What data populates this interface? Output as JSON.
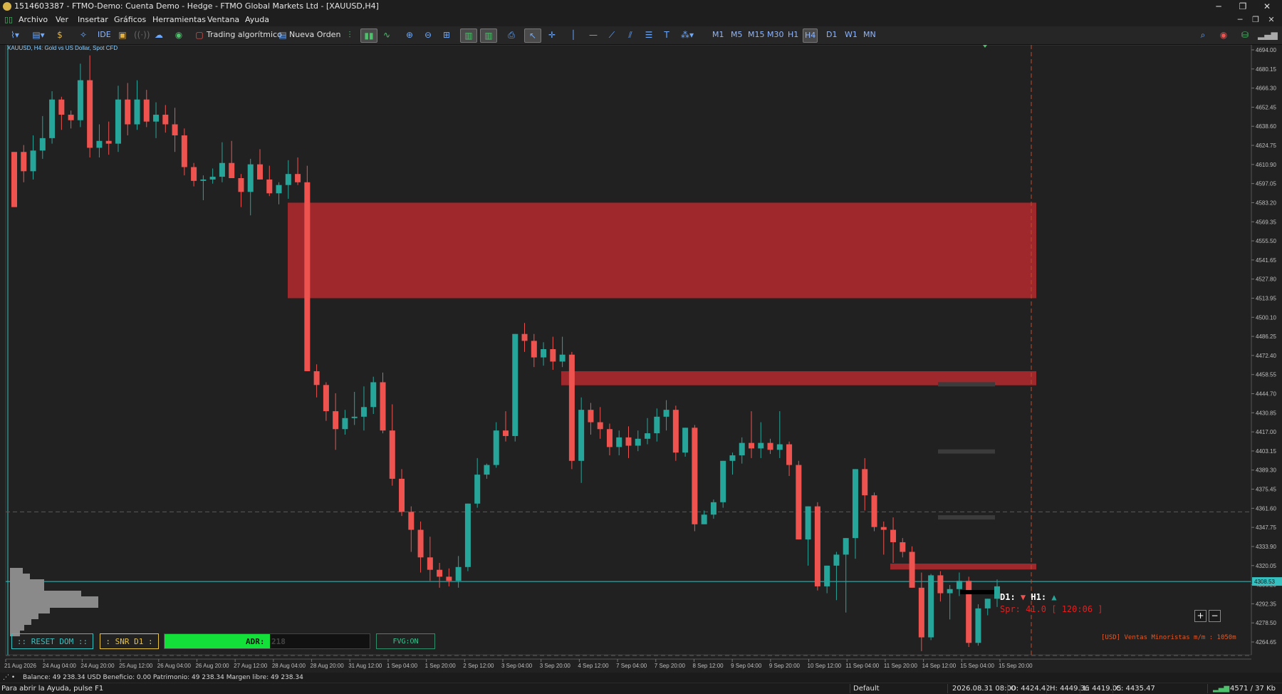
{
  "window": {
    "title": "1514603387 - FTMO-Demo: Cuenta Demo - Hedge - FTMO Global Markets Ltd - [XAUUSD,H4]",
    "controls": [
      "─",
      "❐",
      "✕"
    ]
  },
  "menu": {
    "items": [
      "Archivo",
      "Ver",
      "Insertar",
      "Gráficos",
      "Herramientas",
      "Ventana",
      "Ayuda"
    ],
    "mdi_controls": [
      "─",
      "❐",
      "✕"
    ]
  },
  "toolbar": {
    "ide_label": "IDE",
    "algo_label": "Trading algorítmico",
    "order_label": "Nueva Orden",
    "timeframes": [
      "M1",
      "M5",
      "M15",
      "M30",
      "H1",
      "H4",
      "D1",
      "W1",
      "MN"
    ],
    "active_timeframe": "H4"
  },
  "chart": {
    "symbol_label": "XAUUSD, H4:  Gold vs US Dollar, Spot CFD",
    "current_price": "4308.53",
    "price_labels": [
      "4694.00",
      "4680.15",
      "4666.30",
      "4652.45",
      "4638.60",
      "4624.75",
      "4610.90",
      "4597.05",
      "4583.20",
      "4569.35",
      "4555.50",
      "4541.65",
      "4527.80",
      "4513.95",
      "4500.10",
      "4486.25",
      "4472.40",
      "4458.55",
      "4444.70",
      "4430.85",
      "4417.00",
      "4403.15",
      "4389.30",
      "4375.45",
      "4361.60",
      "4347.75",
      "4333.90",
      "4320.05",
      "4306.20",
      "4292.35",
      "4278.50",
      "4264.65"
    ],
    "time_labels": [
      "21 Aug 2026",
      "24 Aug 04:00",
      "24 Aug 20:00",
      "25 Aug 12:00",
      "26 Aug 04:00",
      "26 Aug 20:00",
      "27 Aug 12:00",
      "28 Aug 04:00",
      "28 Aug 20:00",
      "31 Aug 12:00",
      "1 Sep 04:00",
      "1 Sep 20:00",
      "2 Sep 12:00",
      "3 Sep 04:00",
      "3 Sep 20:00",
      "4 Sep 12:00",
      "7 Sep 04:00",
      "7 Sep 20:00",
      "8 Sep 12:00",
      "9 Sep 04:00",
      "9 Sep 20:00",
      "10 Sep 12:00",
      "11 Sep 04:00",
      "11 Sep 20:00",
      "14 Sep 12:00",
      "15 Sep 04:00",
      "15 Sep 20:00"
    ],
    "candles": [
      [
        4620,
        4608,
        4586,
        4580
      ],
      [
        4620,
        4625,
        4598,
        4606
      ],
      [
        4606,
        4632,
        4600,
        4621
      ],
      [
        4621,
        4646,
        4615,
        4630
      ],
      [
        4630,
        4664,
        4626,
        4658
      ],
      [
        4658,
        4660,
        4636,
        4647
      ],
      [
        4647,
        4650,
        4637,
        4643
      ],
      [
        4643,
        4684,
        4638,
        4672
      ],
      [
        4672,
        4690,
        4616,
        4623
      ],
      [
        4623,
        4640,
        4616,
        4628
      ],
      [
        4628,
        4642,
        4618,
        4626
      ],
      [
        4626,
        4668,
        4620,
        4658
      ],
      [
        4658,
        4670,
        4632,
        4640
      ],
      [
        4640,
        4672,
        4636,
        4658
      ],
      [
        4658,
        4665,
        4638,
        4642
      ],
      [
        4642,
        4656,
        4630,
        4647
      ],
      [
        4647,
        4654,
        4634,
        4640
      ],
      [
        4640,
        4652,
        4620,
        4632
      ],
      [
        4632,
        4637,
        4603,
        4609
      ],
      [
        4609,
        4612,
        4595,
        4599
      ],
      [
        4599,
        4603,
        4585,
        4600
      ],
      [
        4600,
        4608,
        4597,
        4602
      ],
      [
        4602,
        4627,
        4598,
        4612
      ],
      [
        4612,
        4628,
        4604,
        4601
      ],
      [
        4601,
        4604,
        4580,
        4591
      ],
      [
        4591,
        4615,
        4574,
        4611
      ],
      [
        4611,
        4622,
        4602,
        4600
      ],
      [
        4600,
        4610,
        4588,
        4590
      ],
      [
        4590,
        4598,
        4582,
        4596
      ],
      [
        4596,
        4614,
        4586,
        4604
      ],
      [
        4604,
        4616,
        4596,
        4598
      ],
      [
        4598,
        4610,
        4535,
        4461
      ],
      [
        4461,
        4466,
        4442,
        4451
      ],
      [
        4451,
        4453,
        4425,
        4432
      ],
      [
        4432,
        4445,
        4404,
        4419
      ],
      [
        4419,
        4433,
        4415,
        4427
      ],
      [
        4427,
        4446,
        4422,
        4428
      ],
      [
        4428,
        4450,
        4418,
        4435
      ],
      [
        4435,
        4457,
        4430,
        4453
      ],
      [
        4453,
        4460,
        4416,
        4418
      ],
      [
        4418,
        4437,
        4378,
        4383
      ],
      [
        4383,
        4390,
        4356,
        4359
      ],
      [
        4359,
        4363,
        4330,
        4346
      ],
      [
        4346,
        4352,
        4315,
        4326
      ],
      [
        4326,
        4341,
        4309,
        4317
      ],
      [
        4317,
        4322,
        4304,
        4312
      ],
      [
        4312,
        4318,
        4305,
        4309
      ],
      [
        4309,
        4327,
        4304,
        4319
      ],
      [
        4319,
        4362,
        4316,
        4365
      ],
      [
        4365,
        4398,
        4362,
        4386
      ],
      [
        4386,
        4394,
        4383,
        4393
      ],
      [
        4393,
        4424,
        4391,
        4418
      ],
      [
        4418,
        4432,
        4410,
        4414
      ],
      [
        4414,
        4474,
        4410,
        4488
      ],
      [
        4488,
        4496,
        4475,
        4483
      ],
      [
        4483,
        4488,
        4464,
        4471
      ],
      [
        4471,
        4482,
        4465,
        4477
      ],
      [
        4477,
        4486,
        4462,
        4468
      ],
      [
        4468,
        4486,
        4464,
        4473
      ],
      [
        4473,
        4475,
        4390,
        4396
      ],
      [
        4396,
        4442,
        4380,
        4433
      ],
      [
        4433,
        4438,
        4415,
        4424
      ],
      [
        4424,
        4435,
        4412,
        4419
      ],
      [
        4419,
        4423,
        4400,
        4406
      ],
      [
        4406,
        4418,
        4400,
        4413
      ],
      [
        4413,
        4421,
        4398,
        4407
      ],
      [
        4407,
        4418,
        4403,
        4412
      ],
      [
        4412,
        4427,
        4408,
        4416
      ],
      [
        4416,
        4434,
        4410,
        4428
      ],
      [
        4428,
        4440,
        4418,
        4433
      ],
      [
        4433,
        4436,
        4396,
        4402
      ],
      [
        4402,
        4418,
        4399,
        4420
      ],
      [
        4420,
        4422,
        4345,
        4350
      ],
      [
        4350,
        4360,
        4352,
        4357
      ],
      [
        4357,
        4368,
        4354,
        4366
      ],
      [
        4366,
        4394,
        4362,
        4396
      ],
      [
        4396,
        4402,
        4386,
        4400
      ],
      [
        4400,
        4413,
        4394,
        4409
      ],
      [
        4409,
        4432,
        4398,
        4405
      ],
      [
        4405,
        4424,
        4398,
        4409
      ],
      [
        4409,
        4412,
        4401,
        4404
      ],
      [
        4404,
        4432,
        4398,
        4408
      ],
      [
        4408,
        4410,
        4385,
        4393
      ],
      [
        4393,
        4396,
        4363,
        4339
      ],
      [
        4339,
        4350,
        4320,
        4363
      ],
      [
        4363,
        4366,
        4302,
        4305
      ],
      [
        4305,
        4318,
        4300,
        4320
      ],
      [
        4320,
        4330,
        4295,
        4328
      ],
      [
        4328,
        4339,
        4286,
        4340
      ],
      [
        4340,
        4390,
        4325,
        4390
      ],
      [
        4390,
        4398,
        4360,
        4371
      ],
      [
        4371,
        4373,
        4345,
        4348
      ],
      [
        4348,
        4352,
        4328,
        4346
      ],
      [
        4346,
        4355,
        4322,
        4337
      ],
      [
        4337,
        4340,
        4326,
        4330
      ],
      [
        4330,
        4334,
        4308,
        4304
      ],
      [
        4304,
        4315,
        4258,
        4268
      ],
      [
        4268,
        4314,
        4266,
        4313
      ],
      [
        4313,
        4316,
        4294,
        4300
      ],
      [
        4300,
        4306,
        4281,
        4303
      ],
      [
        4303,
        4315,
        4298,
        4309
      ],
      [
        4309,
        4312,
        4261,
        4264
      ],
      [
        4264,
        4292,
        4262,
        4289
      ],
      [
        4289,
        4295,
        4284,
        4296
      ],
      [
        4296,
        4310,
        4290,
        4305
      ]
    ],
    "zones": [
      {
        "top": 4583.2,
        "bottom": 4513.95,
        "color": "#a6292d"
      },
      {
        "top": 4461.0,
        "bottom": 4450.8,
        "color": "#a6292d"
      },
      {
        "top": 4321.5,
        "bottom": 4317.2,
        "color": "#a6292d"
      }
    ],
    "gray_levels": [
      4451.5,
      4402.8,
      4355.0
    ],
    "dashed_level": 4359.0,
    "overlays": {
      "reset_dom": ":: RESET DOM ::",
      "snr_d1": ": SNR D1 :",
      "adr_label": "ADR:",
      "adr_value": "218",
      "fvg": "FVG:ON",
      "d1_label": "D1:",
      "d1_arrow": "▼",
      "h1_label": "H1:",
      "h1_arrow": "▲",
      "spread_line": "Spr: 41.0 [ 120:06 ]",
      "retail_line": "[USD] Ventas Minoristas m/m : 1050m",
      "zoom_in": "+",
      "zoom_out": "−"
    },
    "colors": {
      "bull": "#26a69a",
      "bear": "#ef5350",
      "zone": "#a6292d",
      "price_line": "#37c0c0",
      "accent_yellow": "#e8c241",
      "adr_green": "#14e03a"
    }
  },
  "status": {
    "account_line": "Balance: 49 238.34 USD  Beneficio: 0.00  Patrimonio: 49 238.34  Margen libre: 49 238.34",
    "help": "Para abrir la Ayuda, pulse F1",
    "profile": "Default",
    "datetime": "2026.08.31 08:00",
    "open": "O: 4424.42",
    "high": "H: 4449.36",
    "low": "L: 4419.05",
    "close": "C: 4435.47",
    "traffic": "4571 / 37 Kb"
  }
}
